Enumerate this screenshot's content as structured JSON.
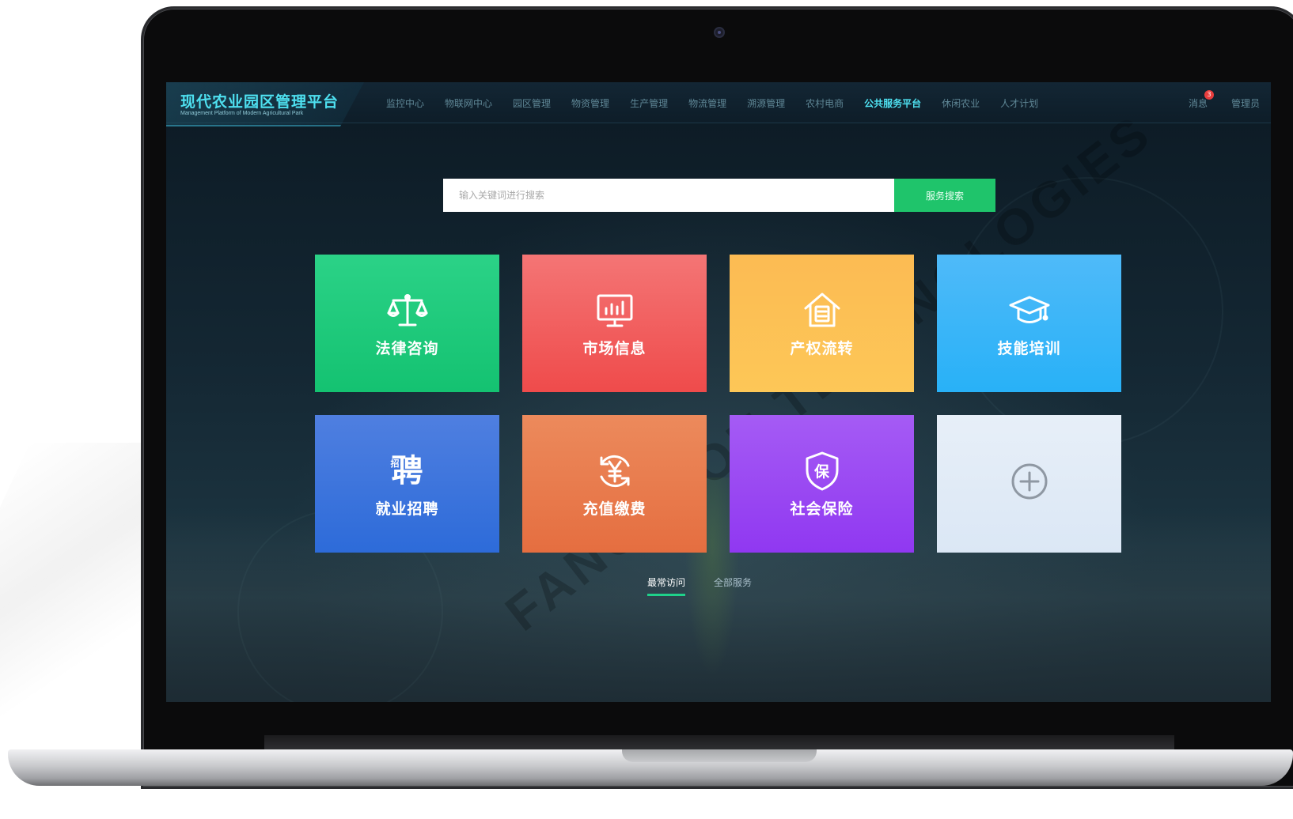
{
  "header": {
    "logo_title": "现代农业园区管理平台",
    "logo_subtitle": "Management Platform of Modern Agricultural Park",
    "nav": [
      {
        "label": "监控中心",
        "active": false
      },
      {
        "label": "物联网中心",
        "active": false
      },
      {
        "label": "园区管理",
        "active": false
      },
      {
        "label": "物资管理",
        "active": false
      },
      {
        "label": "生产管理",
        "active": false
      },
      {
        "label": "物流管理",
        "active": false
      },
      {
        "label": "溯源管理",
        "active": false
      },
      {
        "label": "农村电商",
        "active": false
      },
      {
        "label": "公共服务平台",
        "active": true
      },
      {
        "label": "休闲农业",
        "active": false
      },
      {
        "label": "人才计划",
        "active": false
      }
    ],
    "messages_label": "消息",
    "messages_count": "3",
    "admin_label": "管理员"
  },
  "search": {
    "placeholder": "输入关键词进行搜索",
    "button_label": "服务搜索"
  },
  "tiles": [
    {
      "label": "法律咨询",
      "icon": "scales-icon",
      "color": "#1fca7a"
    },
    {
      "label": "市场信息",
      "icon": "chart-monitor-icon",
      "color": "#f05f5f"
    },
    {
      "label": "产权流转",
      "icon": "house-document-icon",
      "color": "#fdc256"
    },
    {
      "label": "技能培训",
      "icon": "graduation-cap-icon",
      "color": "#33b5f8"
    },
    {
      "label": "就业招聘",
      "icon": "recruit-char-icon",
      "icon_text": "聘",
      "icon_subtext": "招",
      "color": "#3575dc"
    },
    {
      "label": "充值缴费",
      "icon": "yuan-refresh-icon",
      "color": "#e87b4c"
    },
    {
      "label": "社会保险",
      "icon": "insurance-shield-icon",
      "icon_text": "保",
      "color": "#9a48f3"
    },
    {
      "label": "",
      "icon": "add-circle-icon",
      "color": "#e1ebf7"
    }
  ],
  "tabs": [
    {
      "label": "最常访问",
      "active": true
    },
    {
      "label": "全部服务",
      "active": false
    }
  ],
  "watermark": "FANGZHOU TECHNOLOGIES",
  "colors": {
    "accent": "#4fe3f3",
    "search_button": "#1fc46b",
    "tab_underline": "#1fd18a",
    "badge": "#e83d3d"
  }
}
